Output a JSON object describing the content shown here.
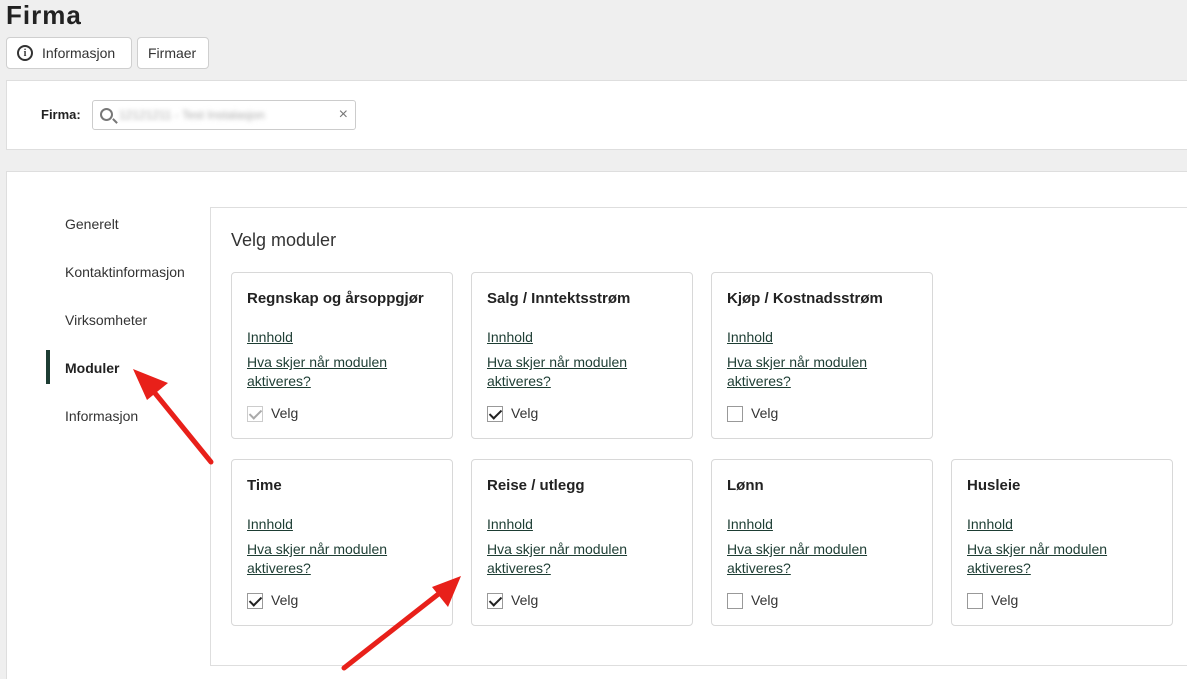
{
  "page": {
    "title": "Firma"
  },
  "toolbar": {
    "info_label": "Informasjon",
    "firmaer_label": "Firmaer"
  },
  "firma": {
    "label": "Firma:",
    "value": "12121211 - Test Instalasjon"
  },
  "sidenav": {
    "items": [
      "Generelt",
      "Kontaktinformasjon",
      "Virksomheter",
      "Moduler",
      "Informasjon"
    ],
    "active": "Moduler"
  },
  "modules": {
    "title": "Velg moduler",
    "content_link": "Innhold",
    "info_link": "Hva skjer når modulen aktiveres?",
    "select_label": "Velg",
    "cards": [
      {
        "title": "Regnskap og årsoppgjør",
        "checked": true,
        "disabled": true
      },
      {
        "title": "Salg / Inntektsstrøm",
        "checked": true,
        "disabled": false
      },
      {
        "title": "Kjøp / Kostnadsstrøm",
        "checked": false,
        "disabled": false
      },
      {
        "title": "Time",
        "checked": true,
        "disabled": false
      },
      {
        "title": "Reise / utlegg",
        "checked": true,
        "disabled": false
      },
      {
        "title": "Lønn",
        "checked": false,
        "disabled": false
      },
      {
        "title": "Husleie",
        "checked": false,
        "disabled": false
      }
    ]
  },
  "colors": {
    "accent": "#1d3d33",
    "annotation_arrow": "#e8201a"
  }
}
